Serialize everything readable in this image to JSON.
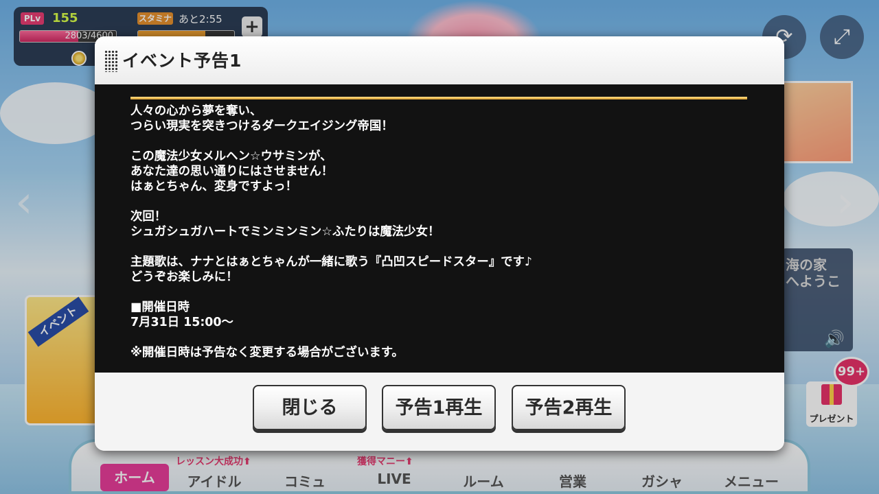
{
  "status": {
    "plv_label": "PLv",
    "plv_value": "155",
    "exp_text": "2803/4600",
    "exp_fraction": 0.61,
    "stamina_label": "スタミナ",
    "stamina_time": "あと2:55",
    "plus_label": "+"
  },
  "background": {
    "event_ribbon": "イベント",
    "sea_house_text": "海の家\nへようこ",
    "present_count": "99+",
    "present_label": "プレゼント"
  },
  "nav": {
    "home": "ホーム",
    "idol": "アイドル",
    "commu": "コミュ",
    "live": "LIVE",
    "room": "ルーム",
    "eigyo": "営業",
    "gacha": "ガシャ",
    "menu": "メニュー",
    "lesson_tag": "レッスン大成功⬆",
    "money_tag": "獲得マニー⬆"
  },
  "modal": {
    "title": "イベント予告1",
    "body": "人々の心から夢を奪い、\nつらい現実を突きつけるダークエイジング帝国！\n\nこの魔法少女メルヘン☆ウサミンが、\nあなた達の思い通りにはさせません！\nはぁとちゃん、変身ですよっ！\n\n次回！\nシュガシュガハートでミンミンミン☆ふたりは魔法少女！\n\n主題歌は、ナナとはぁとちゃんが一緒に歌う『凸凹スピードスター』です♪\nどうぞお楽しみに！\n\n■開催日時\n7月31日 15:00〜\n\n※開催日時は予告なく変更する場合がございます。",
    "buttons": {
      "close": "閉じる",
      "play1": "予告1再生",
      "play2": "予告2再生"
    }
  },
  "colors": {
    "plv": "#e83e73",
    "stamina": "#e6902e",
    "gold_line": "#d79b2b",
    "modal_body_bg": "#121212"
  }
}
